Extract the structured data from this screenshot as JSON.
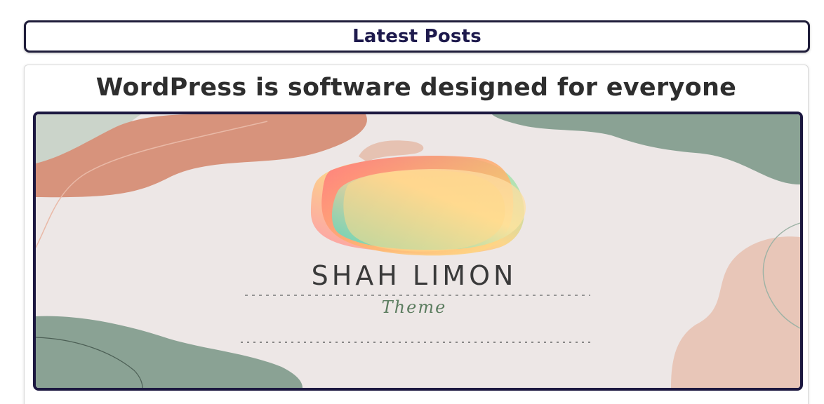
{
  "section": {
    "title": "Latest Posts"
  },
  "post": {
    "title": "WordPress is software designed for everyone",
    "thumbnail": {
      "brand": "SHAH LIMON",
      "tagline": "Theme"
    }
  },
  "colors": {
    "heading": "#1e1a4d",
    "title": "#2e2e2e",
    "frame_border": "#1c1840",
    "canvas_bg": "#ede7e6",
    "terracotta": "#d7937c",
    "sage": "#8aa294",
    "peach": "#e8c6b8"
  }
}
